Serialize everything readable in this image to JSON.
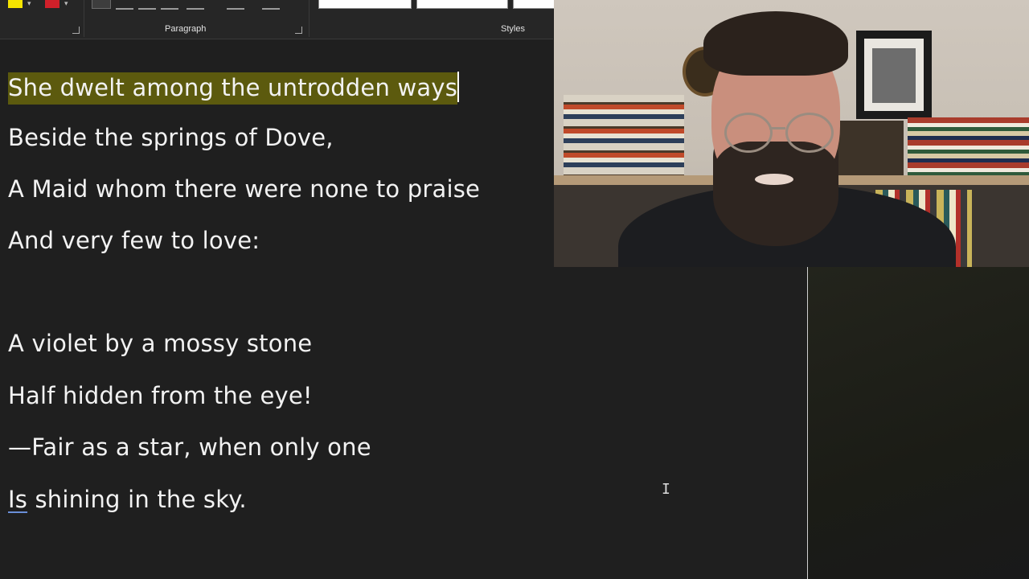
{
  "ribbon": {
    "groups": [
      {
        "label": ""
      },
      {
        "label": "Paragraph"
      },
      {
        "label": "Styles"
      }
    ],
    "colors": {
      "highlight": "#f5e400",
      "font_color": "#d0202a"
    }
  },
  "document": {
    "lines": [
      "She dwelt among the untrodden ways",
      "Beside the springs of Dove,",
      "A Maid whom there were none to praise",
      "And very few to love:",
      "",
      "A violet by a mossy stone",
      "Half hidden from the eye!",
      "—Fair as a star, when only one"
    ],
    "last_line": {
      "underlined_word": "Is",
      "rest": " shining in the sky."
    },
    "selection_color": "#5c5a0e"
  },
  "webcam": {
    "label": "presenter-webcam"
  }
}
